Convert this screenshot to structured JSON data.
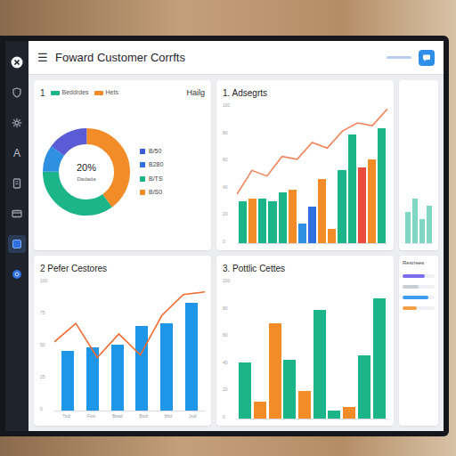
{
  "header": {
    "menu_icon": "☰",
    "title": "Foward Customer Corrfts"
  },
  "sidebar": {
    "items": [
      {
        "kind": "logo",
        "selected": false
      },
      {
        "kind": "shield",
        "selected": false
      },
      {
        "kind": "gear",
        "selected": false
      },
      {
        "kind": "glyph",
        "glyph": "A",
        "selected": false
      },
      {
        "kind": "doc",
        "selected": false
      },
      {
        "kind": "card",
        "selected": false
      },
      {
        "kind": "folder",
        "selected": true
      },
      {
        "kind": "globe",
        "selected": false
      }
    ]
  },
  "donut_panel": {
    "number": "1",
    "legend": [
      {
        "label": "Beddrdes",
        "color": "#1cb589"
      },
      {
        "label": "Hets",
        "color": "#f28c28"
      }
    ],
    "corner_label": "Hailg",
    "center_value": "20%",
    "center_label": "Dadada",
    "segments": [
      {
        "value": 40,
        "color": "#f28c28"
      },
      {
        "value": 35,
        "color": "#1cb589"
      },
      {
        "value": 10,
        "color": "#2f8fe0"
      },
      {
        "value": 15,
        "color": "#5b5bd6"
      }
    ],
    "list": [
      {
        "label": "B/50",
        "color": "#3b5bdb"
      },
      {
        "label": "B280",
        "color": "#2f6fe0"
      },
      {
        "label": "B/TS",
        "color": "#1cb589"
      },
      {
        "label": "B/S0",
        "color": "#f28c28"
      }
    ]
  },
  "charts": [
    {
      "title": "1. Adsegrts",
      "ticks": [
        "100",
        "80",
        "60",
        "40",
        "20",
        "0"
      ],
      "bars": [
        {
          "value": 30,
          "color": "#1cb589"
        },
        {
          "value": 32,
          "color": "#f28c28"
        },
        {
          "value": 32,
          "color": "#1cb589"
        },
        {
          "value": 30,
          "color": "#1cb589"
        },
        {
          "value": 36,
          "color": "#1cb589"
        },
        {
          "value": 38,
          "color": "#f28c28"
        },
        {
          "value": 14,
          "color": "#2f8fe0"
        },
        {
          "value": 26,
          "color": "#2f6fe0"
        },
        {
          "value": 46,
          "color": "#f28c28"
        },
        {
          "value": 10,
          "color": "#f28c28"
        },
        {
          "value": 52,
          "color": "#1cb589"
        },
        {
          "value": 78,
          "color": "#1cb589"
        },
        {
          "value": 54,
          "color": "#e94c3d"
        },
        {
          "value": 60,
          "color": "#f28c28"
        },
        {
          "value": 82,
          "color": "#1cb589"
        }
      ],
      "line": [
        35,
        52,
        48,
        62,
        60,
        72,
        68,
        80,
        86,
        84,
        96
      ],
      "line_color": "#f2845a",
      "x_labels": []
    },
    {
      "title": "2 Pefer Cestores",
      "ticks": [
        "100",
        "75",
        "50",
        "25",
        "0"
      ],
      "bars": [
        {
          "value": 45,
          "color": "#1f95e8"
        },
        {
          "value": 48,
          "color": "#1f95e8"
        },
        {
          "value": 50,
          "color": "#1f95e8"
        },
        {
          "value": 64,
          "color": "#1f95e8"
        },
        {
          "value": 66,
          "color": "#1f95e8"
        },
        {
          "value": 82,
          "color": "#1f95e8"
        }
      ],
      "line": [
        52,
        66,
        40,
        58,
        42,
        72,
        88,
        90
      ],
      "line_color": "#f26a2e",
      "x_labels": [
        "Tsdl",
        "Fsst",
        "Bead",
        "Bsdl",
        "Mrd",
        "Jsdl"
      ]
    },
    {
      "title": "3. Pottlic Cettes",
      "ticks": [
        "100",
        "80",
        "60",
        "40",
        "20",
        "0"
      ],
      "bars": [
        {
          "value": 40,
          "color": "#1cb589"
        },
        {
          "value": 12,
          "color": "#f28c28"
        },
        {
          "value": 68,
          "color": "#f28c28"
        },
        {
          "value": 42,
          "color": "#1cb589"
        },
        {
          "value": 20,
          "color": "#f28c28"
        },
        {
          "value": 78,
          "color": "#1cb589"
        },
        {
          "value": 6,
          "color": "#1cb589"
        },
        {
          "value": 8,
          "color": "#f28c28"
        },
        {
          "value": 45,
          "color": "#1cb589"
        },
        {
          "value": 86,
          "color": "#1cb589"
        }
      ],
      "line": [],
      "line_color": "#f28c28",
      "x_labels": []
    }
  ],
  "side_panel": {
    "top_bars": [
      {
        "value": 60,
        "color": "#7fd6c4"
      },
      {
        "value": 85,
        "color": "#7fd6c4"
      },
      {
        "value": 45,
        "color": "#7fd6c4"
      },
      {
        "value": 72,
        "color": "#7fd6c4"
      }
    ],
    "title": "Resrrees",
    "rows": [
      {
        "level": 0.7,
        "color": "#7b6cf0"
      },
      {
        "level": 0.5,
        "color": "#c9cdd4"
      },
      {
        "level": 0.8,
        "color": "#3b9cf0"
      },
      {
        "level": 0.45,
        "color": "#f2a14a"
      }
    ]
  }
}
